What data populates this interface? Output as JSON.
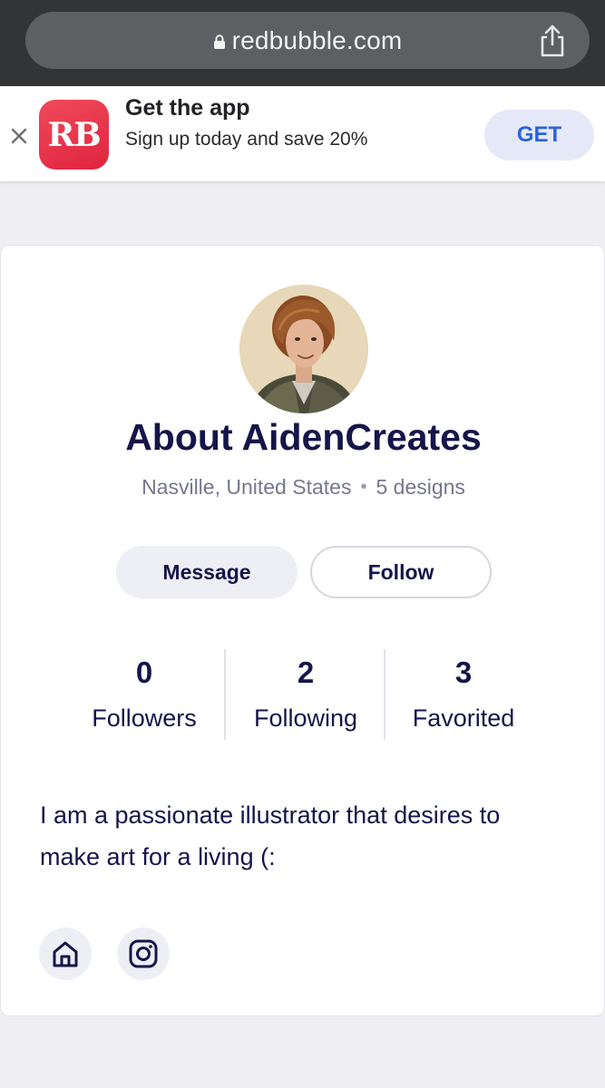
{
  "browser": {
    "url": "redbubble.com",
    "icons": {
      "lock": "lock-icon",
      "share": "share-icon"
    }
  },
  "app_banner": {
    "logo_text": "RB",
    "title": "Get the app",
    "subtitle": "Sign up today and save 20%",
    "get_label": "GET",
    "colors": {
      "logo": "#e8304a",
      "get_text": "#2b63d9",
      "get_bg": "#e5e8f7"
    }
  },
  "profile": {
    "title": "About AidenCreates",
    "location": "Nasville, United States",
    "separator": "•",
    "designs": "5 designs",
    "message_label": "Message",
    "follow_label": "Follow",
    "stats": [
      {
        "value": "0",
        "label": "Followers"
      },
      {
        "value": "2",
        "label": "Following"
      },
      {
        "value": "3",
        "label": "Favorited"
      }
    ],
    "bio": "I am a passionate illustrator that desires to make art for a living (:",
    "social_icons": [
      "home-icon",
      "instagram-icon"
    ],
    "colors": {
      "text": "#16154a",
      "muted": "#76768f"
    }
  }
}
